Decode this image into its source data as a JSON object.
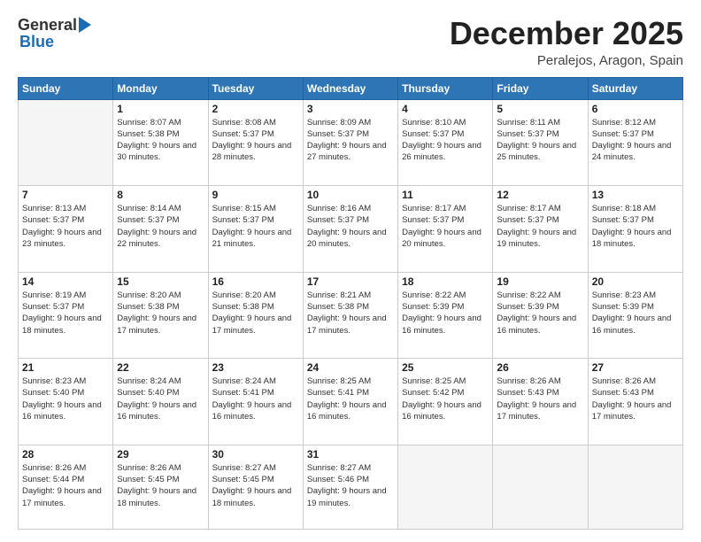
{
  "header": {
    "logo": {
      "general": "General",
      "blue": "Blue"
    },
    "title": "December 2025",
    "location": "Peralejos, Aragon, Spain"
  },
  "calendar": {
    "days_of_week": [
      "Sunday",
      "Monday",
      "Tuesday",
      "Wednesday",
      "Thursday",
      "Friday",
      "Saturday"
    ],
    "weeks": [
      [
        {
          "day": "",
          "sunrise": "",
          "sunset": "",
          "daylight": ""
        },
        {
          "day": "1",
          "sunrise": "Sunrise: 8:07 AM",
          "sunset": "Sunset: 5:38 PM",
          "daylight": "Daylight: 9 hours and 30 minutes."
        },
        {
          "day": "2",
          "sunrise": "Sunrise: 8:08 AM",
          "sunset": "Sunset: 5:37 PM",
          "daylight": "Daylight: 9 hours and 28 minutes."
        },
        {
          "day": "3",
          "sunrise": "Sunrise: 8:09 AM",
          "sunset": "Sunset: 5:37 PM",
          "daylight": "Daylight: 9 hours and 27 minutes."
        },
        {
          "day": "4",
          "sunrise": "Sunrise: 8:10 AM",
          "sunset": "Sunset: 5:37 PM",
          "daylight": "Daylight: 9 hours and 26 minutes."
        },
        {
          "day": "5",
          "sunrise": "Sunrise: 8:11 AM",
          "sunset": "Sunset: 5:37 PM",
          "daylight": "Daylight: 9 hours and 25 minutes."
        },
        {
          "day": "6",
          "sunrise": "Sunrise: 8:12 AM",
          "sunset": "Sunset: 5:37 PM",
          "daylight": "Daylight: 9 hours and 24 minutes."
        }
      ],
      [
        {
          "day": "7",
          "sunrise": "Sunrise: 8:13 AM",
          "sunset": "Sunset: 5:37 PM",
          "daylight": "Daylight: 9 hours and 23 minutes."
        },
        {
          "day": "8",
          "sunrise": "Sunrise: 8:14 AM",
          "sunset": "Sunset: 5:37 PM",
          "daylight": "Daylight: 9 hours and 22 minutes."
        },
        {
          "day": "9",
          "sunrise": "Sunrise: 8:15 AM",
          "sunset": "Sunset: 5:37 PM",
          "daylight": "Daylight: 9 hours and 21 minutes."
        },
        {
          "day": "10",
          "sunrise": "Sunrise: 8:16 AM",
          "sunset": "Sunset: 5:37 PM",
          "daylight": "Daylight: 9 hours and 20 minutes."
        },
        {
          "day": "11",
          "sunrise": "Sunrise: 8:17 AM",
          "sunset": "Sunset: 5:37 PM",
          "daylight": "Daylight: 9 hours and 20 minutes."
        },
        {
          "day": "12",
          "sunrise": "Sunrise: 8:17 AM",
          "sunset": "Sunset: 5:37 PM",
          "daylight": "Daylight: 9 hours and 19 minutes."
        },
        {
          "day": "13",
          "sunrise": "Sunrise: 8:18 AM",
          "sunset": "Sunset: 5:37 PM",
          "daylight": "Daylight: 9 hours and 18 minutes."
        }
      ],
      [
        {
          "day": "14",
          "sunrise": "Sunrise: 8:19 AM",
          "sunset": "Sunset: 5:37 PM",
          "daylight": "Daylight: 9 hours and 18 minutes."
        },
        {
          "day": "15",
          "sunrise": "Sunrise: 8:20 AM",
          "sunset": "Sunset: 5:38 PM",
          "daylight": "Daylight: 9 hours and 17 minutes."
        },
        {
          "day": "16",
          "sunrise": "Sunrise: 8:20 AM",
          "sunset": "Sunset: 5:38 PM",
          "daylight": "Daylight: 9 hours and 17 minutes."
        },
        {
          "day": "17",
          "sunrise": "Sunrise: 8:21 AM",
          "sunset": "Sunset: 5:38 PM",
          "daylight": "Daylight: 9 hours and 17 minutes."
        },
        {
          "day": "18",
          "sunrise": "Sunrise: 8:22 AM",
          "sunset": "Sunset: 5:39 PM",
          "daylight": "Daylight: 9 hours and 16 minutes."
        },
        {
          "day": "19",
          "sunrise": "Sunrise: 8:22 AM",
          "sunset": "Sunset: 5:39 PM",
          "daylight": "Daylight: 9 hours and 16 minutes."
        },
        {
          "day": "20",
          "sunrise": "Sunrise: 8:23 AM",
          "sunset": "Sunset: 5:39 PM",
          "daylight": "Daylight: 9 hours and 16 minutes."
        }
      ],
      [
        {
          "day": "21",
          "sunrise": "Sunrise: 8:23 AM",
          "sunset": "Sunset: 5:40 PM",
          "daylight": "Daylight: 9 hours and 16 minutes."
        },
        {
          "day": "22",
          "sunrise": "Sunrise: 8:24 AM",
          "sunset": "Sunset: 5:40 PM",
          "daylight": "Daylight: 9 hours and 16 minutes."
        },
        {
          "day": "23",
          "sunrise": "Sunrise: 8:24 AM",
          "sunset": "Sunset: 5:41 PM",
          "daylight": "Daylight: 9 hours and 16 minutes."
        },
        {
          "day": "24",
          "sunrise": "Sunrise: 8:25 AM",
          "sunset": "Sunset: 5:41 PM",
          "daylight": "Daylight: 9 hours and 16 minutes."
        },
        {
          "day": "25",
          "sunrise": "Sunrise: 8:25 AM",
          "sunset": "Sunset: 5:42 PM",
          "daylight": "Daylight: 9 hours and 16 minutes."
        },
        {
          "day": "26",
          "sunrise": "Sunrise: 8:26 AM",
          "sunset": "Sunset: 5:43 PM",
          "daylight": "Daylight: 9 hours and 17 minutes."
        },
        {
          "day": "27",
          "sunrise": "Sunrise: 8:26 AM",
          "sunset": "Sunset: 5:43 PM",
          "daylight": "Daylight: 9 hours and 17 minutes."
        }
      ],
      [
        {
          "day": "28",
          "sunrise": "Sunrise: 8:26 AM",
          "sunset": "Sunset: 5:44 PM",
          "daylight": "Daylight: 9 hours and 17 minutes."
        },
        {
          "day": "29",
          "sunrise": "Sunrise: 8:26 AM",
          "sunset": "Sunset: 5:45 PM",
          "daylight": "Daylight: 9 hours and 18 minutes."
        },
        {
          "day": "30",
          "sunrise": "Sunrise: 8:27 AM",
          "sunset": "Sunset: 5:45 PM",
          "daylight": "Daylight: 9 hours and 18 minutes."
        },
        {
          "day": "31",
          "sunrise": "Sunrise: 8:27 AM",
          "sunset": "Sunset: 5:46 PM",
          "daylight": "Daylight: 9 hours and 19 minutes."
        },
        {
          "day": "",
          "sunrise": "",
          "sunset": "",
          "daylight": ""
        },
        {
          "day": "",
          "sunrise": "",
          "sunset": "",
          "daylight": ""
        },
        {
          "day": "",
          "sunrise": "",
          "sunset": "",
          "daylight": ""
        }
      ]
    ]
  }
}
